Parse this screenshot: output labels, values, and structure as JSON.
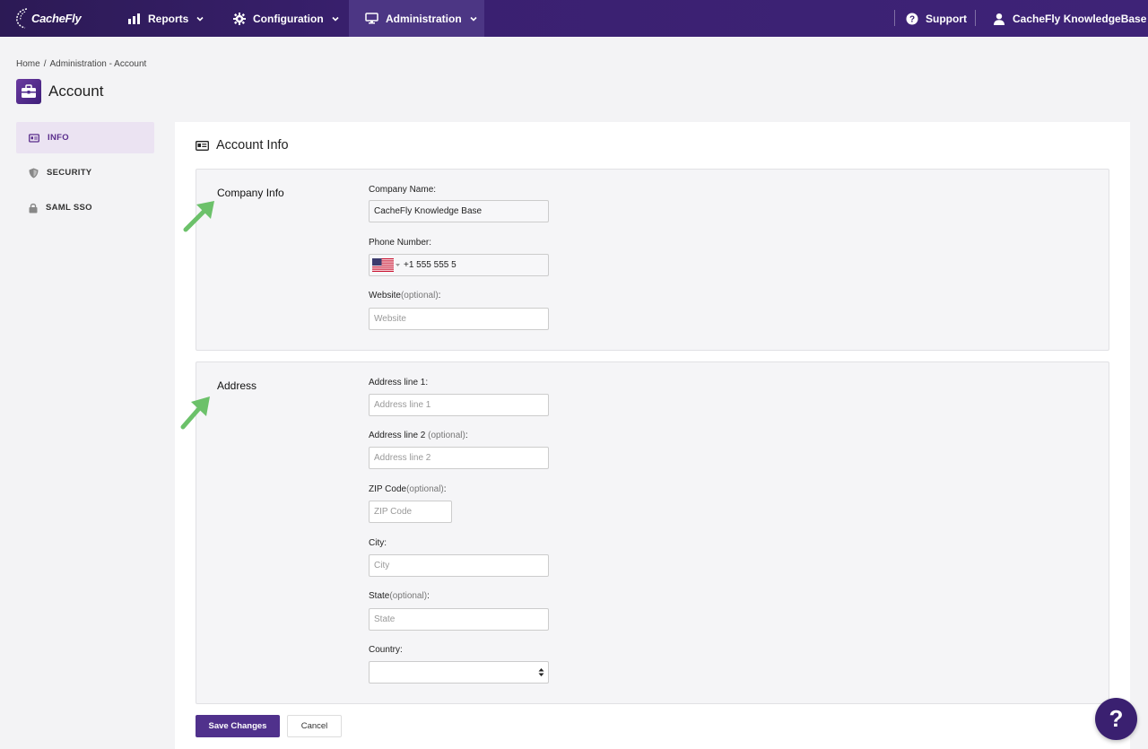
{
  "brand": {
    "name": "CacheFly"
  },
  "nav": {
    "reports": "Reports",
    "configuration": "Configuration",
    "administration": "Administration",
    "support": "Support",
    "account": "CacheFly KnowledgeBase"
  },
  "breadcrumb": {
    "home": "Home",
    "separator": "/",
    "current": "Administration - Account"
  },
  "page": {
    "title": "Account"
  },
  "sidebar": {
    "items": [
      {
        "label": "INFO",
        "icon": "id-card-icon"
      },
      {
        "label": "SECURITY",
        "icon": "shield-icon"
      },
      {
        "label": "SAML SSO",
        "icon": "lock-icon"
      }
    ]
  },
  "card": {
    "title": "Account Info"
  },
  "company": {
    "label": "Company Info",
    "name_label": "Company Name:",
    "name_value": "CacheFly Knowledge Base",
    "phone_label": "Phone Number:",
    "phone_value": "+1 555 555 5",
    "website_label": "Website",
    "website_opt": "(optional)",
    "website_colon": ":",
    "website_placeholder": "Website"
  },
  "address": {
    "label": "Address",
    "line1_label": "Address line 1:",
    "line1_placeholder": "Address line 1",
    "line2_label": "Address line 2 ",
    "line2_opt": "(optional)",
    "line2_colon": ":",
    "line2_placeholder": "Address line 2",
    "zip_label": "ZIP Code",
    "zip_opt": "(optional)",
    "zip_colon": ":",
    "zip_placeholder": "ZIP Code",
    "city_label": "City:",
    "city_placeholder": "City",
    "state_label": "State",
    "state_opt": "(optional)",
    "state_colon": ":",
    "state_placeholder": "State",
    "country_label": "Country:",
    "country_value": ""
  },
  "actions": {
    "save": "Save Changes",
    "cancel": "Cancel"
  },
  "help": {
    "label": "?"
  },
  "colors": {
    "nav_bg": "#3a2070",
    "accent": "#50318c",
    "arrow": "#6cc16a"
  }
}
